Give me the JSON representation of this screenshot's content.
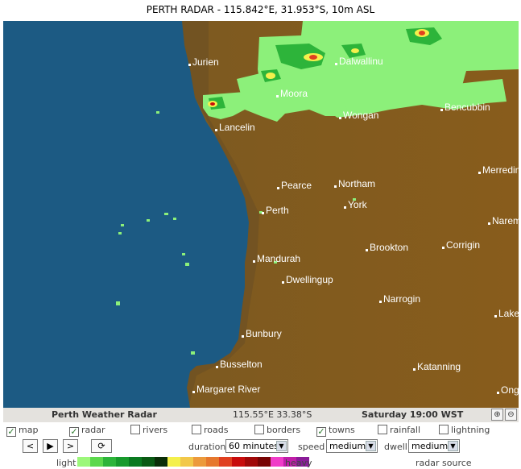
{
  "title": "PERTH RADAR   -   115.842°E, 31.953°S, 10m ASL",
  "towns": [
    {
      "name": "Jurien"
    },
    {
      "name": "Dalwallinu"
    },
    {
      "name": "Moora"
    },
    {
      "name": "Bencubbin"
    },
    {
      "name": "Wongan"
    },
    {
      "name": "Lancelin"
    },
    {
      "name": "Merredin"
    },
    {
      "name": "Pearce"
    },
    {
      "name": "Northam"
    },
    {
      "name": "Perth"
    },
    {
      "name": "York"
    },
    {
      "name": "Narem"
    },
    {
      "name": "Brookton"
    },
    {
      "name": "Corrigin"
    },
    {
      "name": "Mandurah"
    },
    {
      "name": "Dwellingup"
    },
    {
      "name": "Narrogin"
    },
    {
      "name": "Lake"
    },
    {
      "name": "Bunbury"
    },
    {
      "name": "Busselton"
    },
    {
      "name": "Katanning"
    },
    {
      "name": "Margaret River"
    },
    {
      "name": "Ong"
    }
  ],
  "status": {
    "title": "Perth Weather Radar",
    "coords": "115.55°E 33.38°S",
    "time": "Saturday 19:00 WST",
    "zoom_in_icon": "zoom-in-icon",
    "zoom_out_icon": "zoom-out-icon"
  },
  "layers": [
    {
      "label": "map",
      "checked": true
    },
    {
      "label": "radar",
      "checked": true
    },
    {
      "label": "rivers",
      "checked": false
    },
    {
      "label": "roads",
      "checked": false
    },
    {
      "label": "borders",
      "checked": false
    },
    {
      "label": "towns",
      "checked": true
    },
    {
      "label": "rainfall",
      "checked": false
    },
    {
      "label": "lightning",
      "checked": false
    }
  ],
  "controls": {
    "prev_icon": "chevron-left-icon",
    "play_icon": "play-icon",
    "next_icon": "chevron-right-icon",
    "refresh_icon": "refresh-icon",
    "duration_label": "duration",
    "duration_value": "60 minutes",
    "speed_label": "speed",
    "speed_value": "medium",
    "dwell_label": "dwell",
    "dwell_value": "medium"
  },
  "legend": {
    "light_label": "light",
    "heavy_label": "heavy",
    "colors": [
      "#9cf77a",
      "#5cd84c",
      "#2db43a",
      "#189a2c",
      "#0a7a20",
      "#0a5a14",
      "#0a2e08",
      "#f4f04c",
      "#f2c84a",
      "#ec9a3c",
      "#e6782e",
      "#e04020",
      "#c80c0c",
      "#a00808",
      "#780404",
      "#f03cc8",
      "#c01ea8",
      "#8a1c98"
    ],
    "source_label": "radar source"
  },
  "colors": {
    "ocean": "#1c5a83",
    "land": "#7d5a22",
    "rain_light": "#8cf07a"
  }
}
